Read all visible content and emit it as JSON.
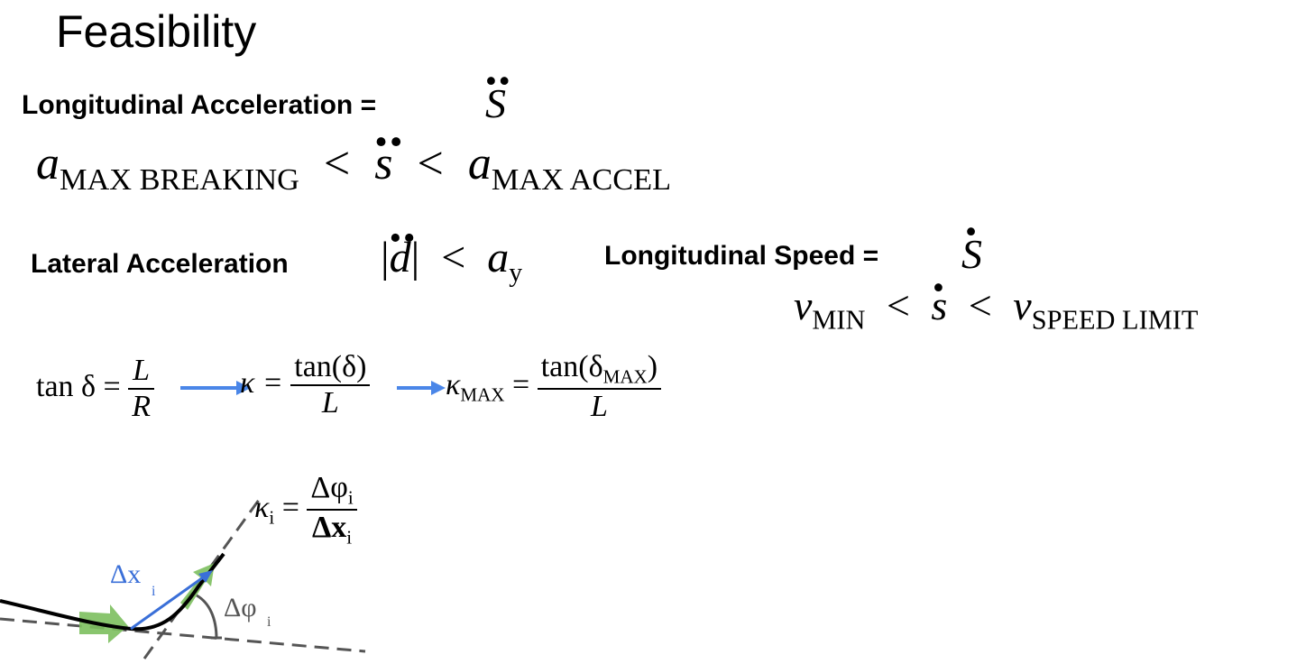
{
  "title": "Feasibility",
  "longitudinal_acceleration": {
    "label": "Longitudinal Acceleration =",
    "symbol": "S",
    "dots": "¨",
    "constraint": {
      "lhs_var": "a",
      "lhs_sub": "MAX BREAKING",
      "op1": "<",
      "mid": "s",
      "op2": "<",
      "rhs_var": "a",
      "rhs_sub": "MAX ACCEL"
    }
  },
  "lateral_acceleration": {
    "label": "Lateral Acceleration",
    "abs_left": "|",
    "var": "d",
    "abs_right": "|",
    "op": "<",
    "rhs_var": "a",
    "rhs_sub": "y"
  },
  "longitudinal_speed": {
    "label": "Longitudinal Speed =",
    "symbol": "S",
    "constraint": {
      "lhs_var": "v",
      "lhs_sub": "MIN",
      "op1": "<",
      "mid": "s",
      "op2": "<",
      "rhs_var": "v",
      "rhs_sub": "SPEED LIMIT"
    }
  },
  "curvature_chain": {
    "eq1_lhs": "tan δ =",
    "eq1_num": "L",
    "eq1_den": "R",
    "eq2_lhs": "κ =",
    "eq2_num": "tan(δ)",
    "eq2_den": "L",
    "eq3_lhs_var": "κ",
    "eq3_lhs_sub": "MAX",
    "eq3_eq": "=",
    "eq3_num_pre": "tan(δ",
    "eq3_num_sub": "MAX",
    "eq3_num_post": ")",
    "eq3_den": "L",
    "arrow_color": "#4a86e8"
  },
  "diagram": {
    "kappa_label": "κ",
    "kappa_sub": "i",
    "eq": "=",
    "num": "Δφ",
    "num_sub": "i",
    "den": "Δx",
    "den_sub": "i",
    "dx_label": "Δx",
    "dx_sub": "i",
    "dphi_label": "Δφ",
    "dphi_sub": "i",
    "colors": {
      "vector": "#3a6fd8",
      "heading_arrow": "#7cbf5e",
      "dash": "#555555",
      "path": "#000000"
    }
  }
}
